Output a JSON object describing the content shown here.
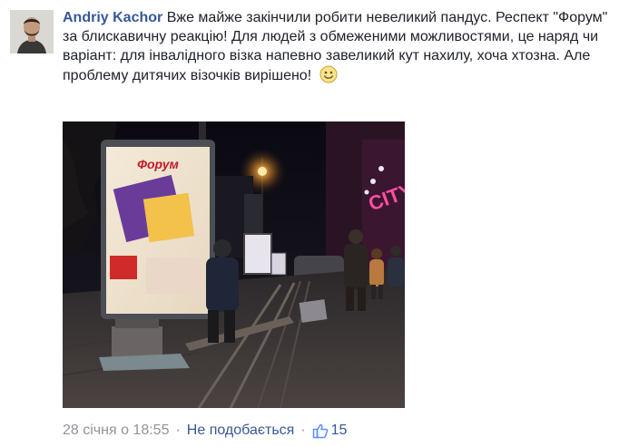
{
  "comment": {
    "author": "Andriy Kachor",
    "text": "Вже майже закінчили робити невеликий пандус. Респект \"Форум\" за блискавичну реакцію! Для людей з обмеженими можливостями, це наряд чи варіант: для інвалідного візка напевно завеликий кут нахилу, хоча хтозна. Але проблему дитячих візочків вирішено!",
    "emoji": "smile-emoji"
  },
  "photo": {
    "sign_text": "Форум"
  },
  "actions": {
    "timestamp": "28 січня о 18:55",
    "separator": "·",
    "unlike_label": "Не подобається",
    "like_icon": "thumbs-up-icon",
    "like_count": "15"
  },
  "colors": {
    "link": "#365899",
    "text": "#1d2129",
    "meta": "#90949c"
  }
}
